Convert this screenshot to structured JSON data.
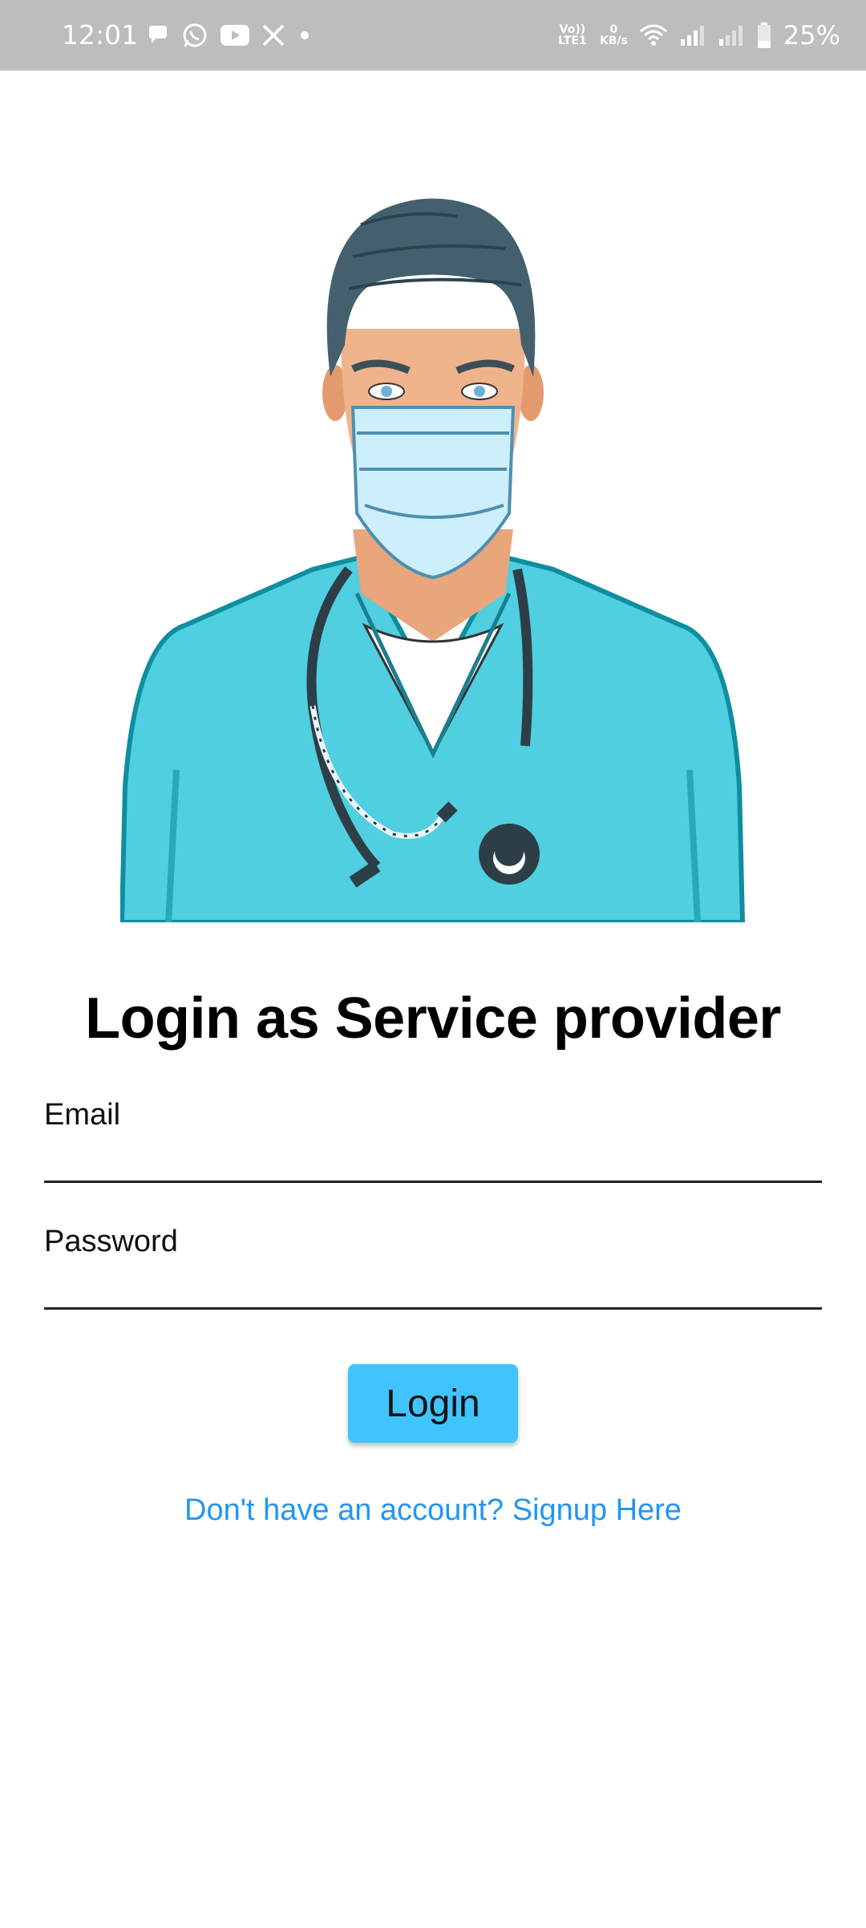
{
  "status_bar": {
    "time": "12:01",
    "left_icons": [
      "chat-bubble-icon",
      "whatsapp-icon",
      "youtube-icon",
      "x-icon",
      "dot-icon"
    ],
    "volte_label": "Vo)) LTE1",
    "net_speed_value": "0",
    "net_speed_unit": "KB/s",
    "battery_percent": "25%"
  },
  "hero": {
    "icon": "doctor-illustration"
  },
  "title": "Login as Service provider",
  "form": {
    "email_label": "Email",
    "email_value": "",
    "password_label": "Password",
    "password_value": ""
  },
  "login_button": "Login",
  "signup_link": "Don't have an account? Signup Here",
  "colors": {
    "status_bar_bg": "#bdbdbd",
    "button_bg": "#40c4ff",
    "link": "#2196f3",
    "scrubs": "#4fcfe0"
  }
}
